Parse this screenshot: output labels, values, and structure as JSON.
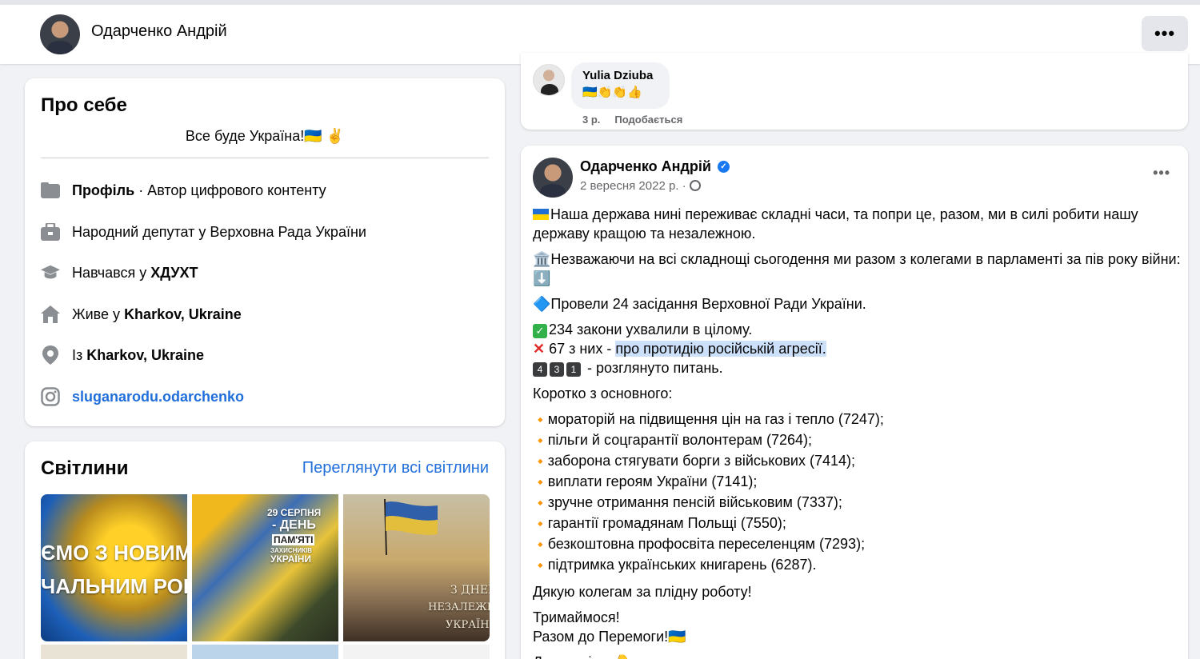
{
  "header": {
    "profile_name": "Одарченко Андрій",
    "more_label": "•••"
  },
  "about": {
    "title": "Про себе",
    "bio": "Все буде Україна!🇺🇦 ✌️",
    "rows": [
      {
        "icon": "briefcase-icon",
        "bold": "Профіль",
        "text": " · Автор цифрового контенту"
      },
      {
        "icon": "work-icon",
        "text": "Народний депутат у Верховна Рада України"
      },
      {
        "icon": "education-icon",
        "prefix": "Навчався у ",
        "bold": "ХДУХТ"
      },
      {
        "icon": "home-icon",
        "prefix": "Живе у ",
        "bold": "Kharkov, Ukraine"
      },
      {
        "icon": "location-pin-icon",
        "prefix": "Із ",
        "bold": "Kharkov, Ukraine"
      },
      {
        "icon": "instagram-icon",
        "link": "sluganarodu.odarchenko"
      }
    ]
  },
  "photos": {
    "title": "Світлини",
    "see_all": "Переглянути всі світлини",
    "items": [
      {
        "lines": [
          "ЄМО З НОВИМ",
          "ЧАЛЬНИМ РОК"
        ]
      },
      {
        "lines": [
          "29 СЕРПНЯ",
          "- ДЕНЬ",
          "ПАМ'ЯТІ",
          "ЗАХИСНИКІВ",
          "УКРАЇНИ"
        ]
      },
      {
        "lines": [
          "З ДНЕМ",
          "НЕЗАЛЕЖН",
          "УКРАЇН"
        ]
      }
    ]
  },
  "comment": {
    "author": "Yulia Dziuba",
    "emojis": "🇺🇦👏👏👍",
    "age": "3 р.",
    "like": "Подобається"
  },
  "post": {
    "author": "Одарченко Андрій",
    "date": "2 вересня 2022 р. ·",
    "more": "•••",
    "para1": "Наша держава нині переживає складні часи, та попри це, разом, ми в силі робити нашу державу кращою та незалежною.",
    "para2": "Незважаючи на всі складнощі сьогодення ми разом з колегами в парламенті за пів року війни:",
    "para3": "Провели 24 засідання Верховної Ради України.",
    "line_laws": "234 закони ухвалили в цілому.",
    "line_67_prefix": " 67 з них - ",
    "line_67_highlight": "про протидію російській агресії.",
    "keycaps": [
      "4",
      "3",
      "1"
    ],
    "line_431": " - розглянуто питань.",
    "summary_title": "Коротко з основного:",
    "bullets": [
      "мораторій на підвищення цін на газ і тепло (7247);",
      "пільги й соцгарантії волонтерам (7264);",
      "заборона стягувати борги з військових (7414);",
      "виплати героям України (7141);",
      "зручне отримання пенсій військовим (7337);",
      "гарантії громадянам Польщі (7550);",
      "безкоштовна профосвіта переселенцям (7293);",
      "підтримка українських книгарень (6287)."
    ],
    "thanks": "Дякую колегам за плідну роботу!",
    "hold_on": "Тримаймося!",
    "victory": "Разом до Перемоги!🇺🇦",
    "more_details": "Детальніше 👇"
  }
}
